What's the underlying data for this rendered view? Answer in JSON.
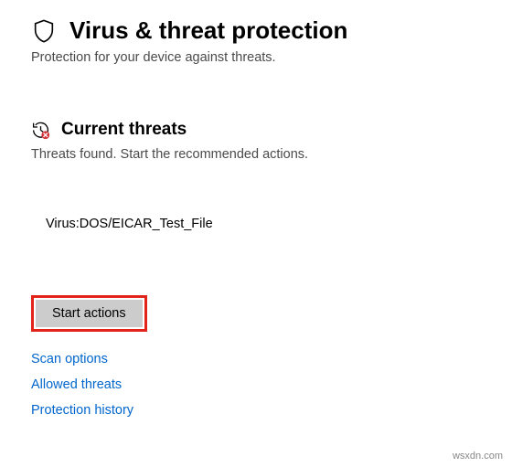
{
  "header": {
    "title": "Virus & threat protection",
    "subtitle": "Protection for your device against threats."
  },
  "section": {
    "title": "Current threats",
    "subtitle": "Threats found. Start the recommended actions."
  },
  "threat": {
    "name": "Virus:DOS/EICAR_Test_File"
  },
  "actions": {
    "start_label": "Start actions"
  },
  "links": {
    "scan_options": "Scan options",
    "allowed_threats": "Allowed threats",
    "protection_history": "Protection history"
  },
  "watermark": "wsxdn.com"
}
